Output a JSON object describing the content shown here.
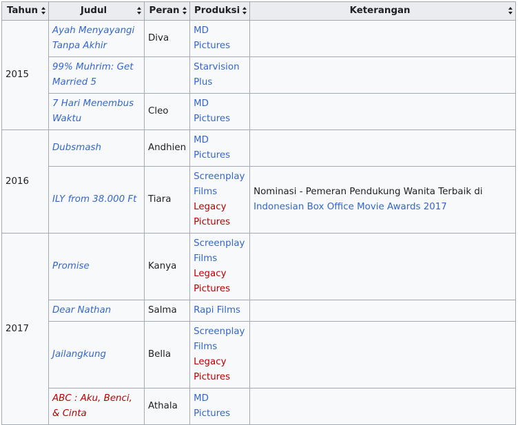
{
  "headers": {
    "tahun": "Tahun",
    "judul": "Judul",
    "peran": "Peran",
    "produksi": "Produksi",
    "keterangan": "Keterangan"
  },
  "icons": {
    "sort": "sort-arrows-icon"
  },
  "colors": {
    "link": "#3366cc",
    "redlink": "#ba0000",
    "header_bg": "#eaecf0",
    "cell_bg": "#f8f9fa",
    "border": "#a2a9b1"
  },
  "years": [
    "2015",
    "2016",
    "2017"
  ],
  "rows": [
    {
      "title": "Ayah Menyayangi Tanpa Akhir",
      "role": "Diva",
      "prod": [
        "MD Pictures"
      ],
      "note": ""
    },
    {
      "title": "99% Muhrim: Get Married 5",
      "role": "",
      "prod": [
        "Starvision Plus"
      ],
      "note": ""
    },
    {
      "title": "7 Hari Menembus Waktu",
      "role": "Cleo",
      "prod": [
        "MD Pictures"
      ],
      "note": ""
    },
    {
      "title": "Dubsmash",
      "role": "Andhien",
      "prod": [
        "MD Pictures"
      ],
      "note": ""
    },
    {
      "title": "ILY from 38.000 Ft",
      "role": "Tiara",
      "prod": [
        "Screenplay Films",
        "Legacy Pictures"
      ],
      "note": "Nominasi - Pemeran Pendukung Wanita Terbaik di ",
      "note_link": "Indonesian Box Office Movie Awards 2017"
    },
    {
      "title": "Promise",
      "role": "Kanya",
      "prod": [
        "Screenplay Films",
        "Legacy Pictures"
      ],
      "note": ""
    },
    {
      "title": "Dear Nathan",
      "role": "Salma",
      "prod": [
        "Rapi Films"
      ],
      "note": ""
    },
    {
      "title": "Jailangkung",
      "role": "Bella",
      "prod": [
        "Screenplay Films",
        "Legacy Pictures"
      ],
      "note": ""
    },
    {
      "title": "ABC : Aku, Benci, & Cinta",
      "role": "Athala",
      "prod": [
        "MD Pictures"
      ],
      "note": ""
    }
  ]
}
